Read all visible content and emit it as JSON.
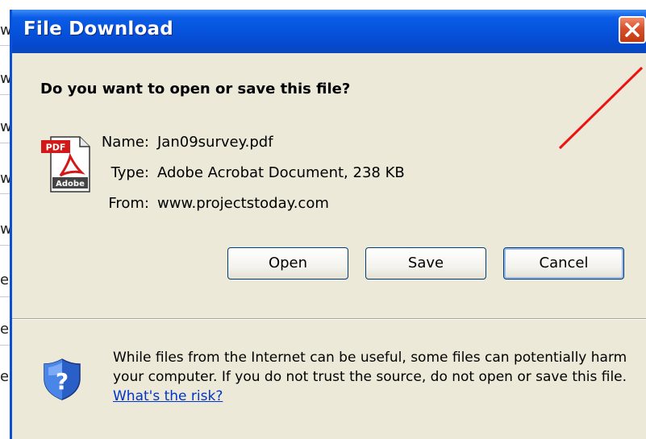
{
  "background": {
    "left_edge_glyphs": [
      "w",
      "w",
      "w",
      "w",
      "w",
      "e",
      "e",
      "e"
    ]
  },
  "dialog": {
    "title": "File Download",
    "question": "Do you want to open or save this file?",
    "file_icon": "pdf-adobe-file-icon",
    "file_icon_label_top": "PDF",
    "file_icon_label_bottom": "Adobe",
    "fields": [
      {
        "label": "Name:",
        "value": "Jan09survey.pdf"
      },
      {
        "label": "Type:",
        "value": "Adobe Acrobat Document, 238 KB"
      },
      {
        "label": "From:",
        "value": "www.projectstoday.com"
      }
    ],
    "buttons": {
      "open": "Open",
      "save": "Save",
      "cancel": "Cancel"
    },
    "warning_text": "While files from the Internet can be useful, some files can potentially harm your computer. If you do not trust the source, do not open or save this file.",
    "risk_link": "What's the risk?"
  },
  "colors": {
    "titlebar": "#0653dc",
    "dialog_bg": "#ece9d8",
    "close_button": "#d8502a",
    "link": "#0033cc",
    "annotation_arrow": "#ee1111"
  }
}
